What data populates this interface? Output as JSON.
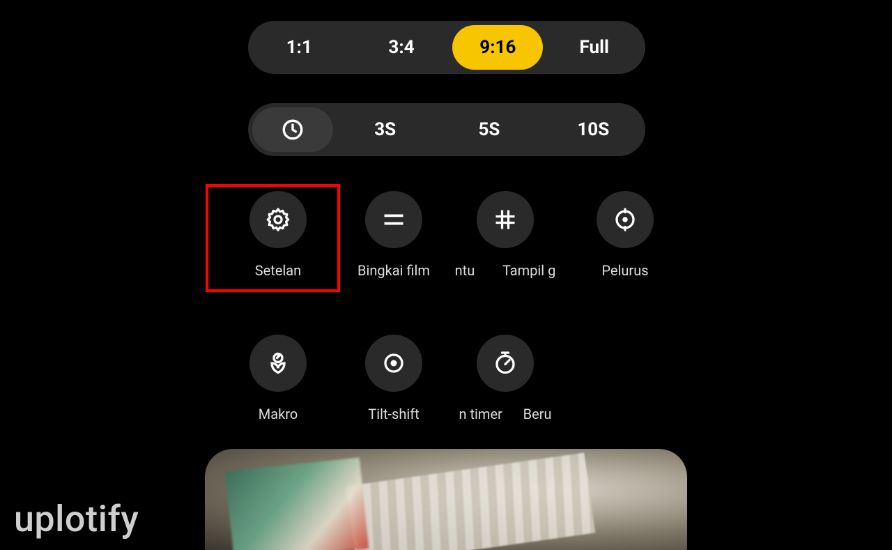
{
  "ratio_bar": {
    "options": [
      "1:1",
      "3:4",
      "9:16",
      "Full"
    ],
    "selected_index": 2
  },
  "timer_bar": {
    "options": [
      "3S",
      "5S",
      "10S"
    ]
  },
  "grid": {
    "row1": [
      {
        "name": "settings",
        "label": "Setelan"
      },
      {
        "name": "film-frame",
        "label": "Bingkai film"
      },
      {
        "name": "grid-lines",
        "label": "ntu"
      },
      {
        "name": "display",
        "label": "Tampil g"
      },
      {
        "name": "straighten",
        "label": "Pelurus"
      }
    ],
    "row2": [
      {
        "name": "macro",
        "label": "Makro"
      },
      {
        "name": "tilt-shift",
        "label": "Tilt-shift"
      },
      {
        "name": "timer",
        "label": "n timer"
      },
      {
        "name": "sequential",
        "label": "Beru"
      }
    ]
  },
  "watermark": "uplotify",
  "colors": {
    "accent": "#f7c600",
    "highlight": "#ff0000",
    "pill_bg": "#2a2a2a"
  }
}
